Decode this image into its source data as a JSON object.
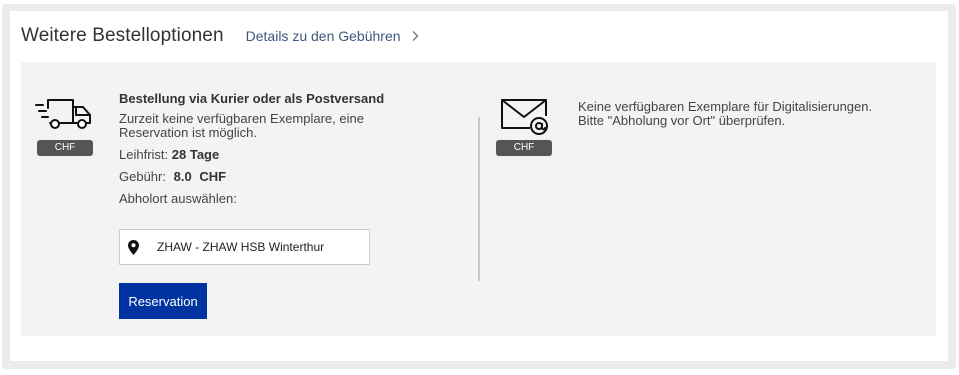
{
  "header": {
    "title": "Weitere Bestelloptionen",
    "details_link": "Details zu den Gebühren"
  },
  "courier_option": {
    "badge": "CHF",
    "title": "Bestellung via Kurier oder als Postversand",
    "availability": "Zurzeit keine verfügbaren Exemplare, eine Reservation ist möglich.",
    "loan_label": "Leihfrist:",
    "loan_value": "28 Tage",
    "fee_label": "Gebühr:",
    "fee_value": "8.0",
    "fee_currency": "CHF",
    "pickup_label": "Abholort auswählen:",
    "pickup_location": "ZHAW - ZHAW HSB Winterthur",
    "reserve_button": "Reservation"
  },
  "digital_option": {
    "badge": "CHF",
    "message_line1": "Keine verfügbaren Exemplare für Digitalisierungen.",
    "message_line2": "Bitte \"Abholung vor Ort\" überprüfen."
  },
  "icons": {
    "courier": "delivery-truck-icon",
    "digital": "envelope-at-icon",
    "location": "map-pin-icon",
    "details": "chevron-right-icon"
  }
}
